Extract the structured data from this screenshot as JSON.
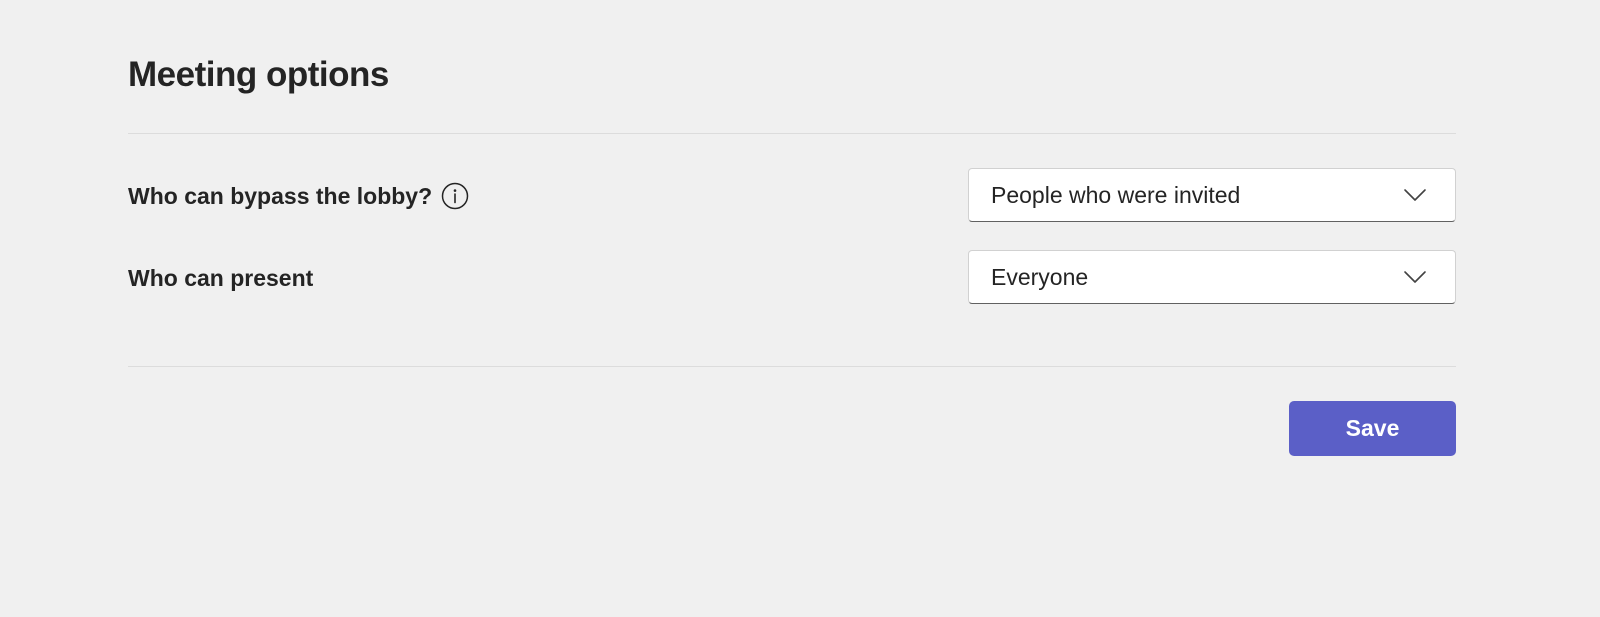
{
  "page": {
    "title": "Meeting options"
  },
  "options": [
    {
      "label": "Who can bypass the lobby?",
      "has_info_icon": true,
      "selected_value": "People who were invited"
    },
    {
      "label": "Who can present",
      "has_info_icon": false,
      "selected_value": "Everyone"
    }
  ],
  "actions": {
    "save_label": "Save"
  },
  "icons": {
    "info": "info-icon",
    "dropdown": "chevron-down-icon"
  },
  "colors": {
    "background": "#f0f0f0",
    "primary_button": "#5b5fc7",
    "text": "#242424",
    "divider": "#dcdcdc"
  }
}
